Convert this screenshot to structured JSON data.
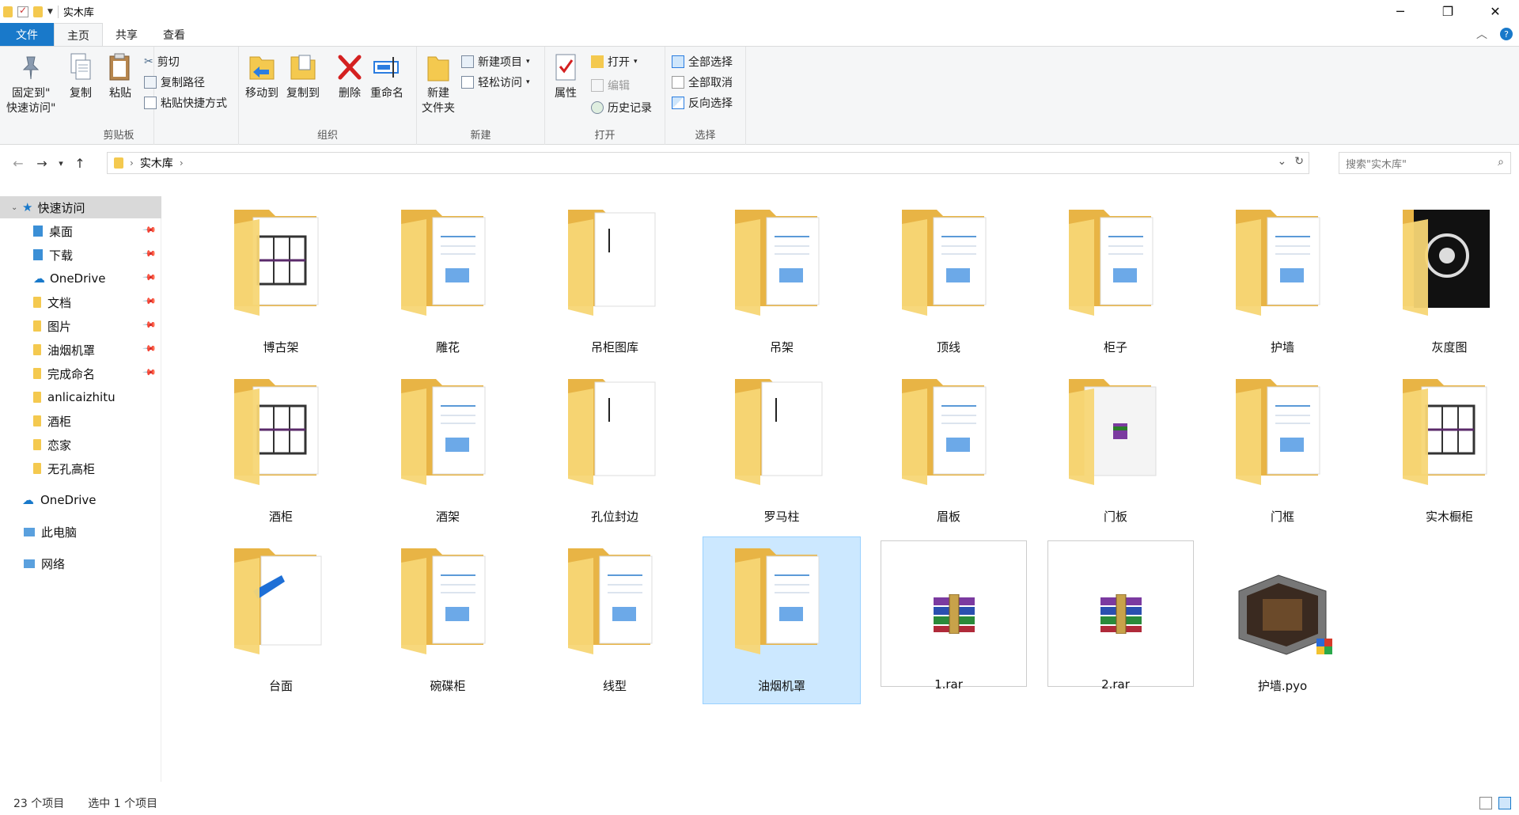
{
  "window": {
    "title": "实木库",
    "controls": {
      "minimize": "─",
      "maximize": "❐",
      "close": "✕"
    }
  },
  "ribbon_tabs": [
    {
      "label": "文件",
      "style": "file"
    },
    {
      "label": "主页",
      "style": "active"
    },
    {
      "label": "共享",
      "style": ""
    },
    {
      "label": "查看",
      "style": ""
    }
  ],
  "ribbon": {
    "clipboard": {
      "label": "剪贴板",
      "pin_label_1": "固定到\"",
      "pin_label_2": "快速访问\"",
      "copy": "复制",
      "paste": "粘贴",
      "cut": "剪切",
      "copy_path": "复制路径",
      "paste_shortcut": "粘贴快捷方式"
    },
    "organize": {
      "label": "组织",
      "move_to": "移动到",
      "copy_to": "复制到",
      "delete": "删除",
      "rename": "重命名"
    },
    "new": {
      "label": "新建",
      "new_folder_1": "新建",
      "new_folder_2": "文件夹",
      "new_item": "新建项目",
      "easy_access": "轻松访问"
    },
    "open": {
      "label": "打开",
      "properties": "属性",
      "open": "打开",
      "edit": "编辑",
      "history": "历史记录"
    },
    "select": {
      "label": "选择",
      "select_all": "全部选择",
      "select_none": "全部取消",
      "invert": "反向选择"
    }
  },
  "address": {
    "path": [
      "实木库"
    ],
    "search_placeholder": "搜索\"实木库\""
  },
  "sidebar": {
    "quick_access": "快速访问",
    "items": [
      {
        "label": "桌面",
        "pinned": true,
        "icon": "desktop-folder"
      },
      {
        "label": "下载",
        "pinned": true,
        "icon": "download-folder"
      },
      {
        "label": "OneDrive",
        "pinned": true,
        "icon": "cloud"
      },
      {
        "label": "文档",
        "pinned": true,
        "icon": "documents-folder"
      },
      {
        "label": "图片",
        "pinned": true,
        "icon": "pictures-folder"
      },
      {
        "label": "油烟机罩",
        "pinned": true,
        "icon": "folder"
      },
      {
        "label": "完成命名",
        "pinned": true,
        "icon": "folder"
      },
      {
        "label": "anlicaizhitu",
        "pinned": false,
        "icon": "folder"
      },
      {
        "label": "酒柜",
        "pinned": false,
        "icon": "folder"
      },
      {
        "label": "恋家",
        "pinned": false,
        "icon": "folder"
      },
      {
        "label": "无孔高柜",
        "pinned": false,
        "icon": "folder"
      }
    ],
    "onedrive": "OneDrive",
    "this_pc": "此电脑",
    "network": "网络"
  },
  "files": [
    {
      "name": "博古架",
      "type": "folder-shelf"
    },
    {
      "name": "雕花",
      "type": "folder"
    },
    {
      "name": "吊柜图库",
      "type": "folder-white"
    },
    {
      "name": "吊架",
      "type": "folder"
    },
    {
      "name": "顶线",
      "type": "folder"
    },
    {
      "name": "柜子",
      "type": "folder"
    },
    {
      "name": "护墙",
      "type": "folder"
    },
    {
      "name": "灰度图",
      "type": "folder-gray"
    },
    {
      "name": "酒柜",
      "type": "folder-shelf"
    },
    {
      "name": "酒架",
      "type": "folder"
    },
    {
      "name": "孔位封边",
      "type": "folder-white"
    },
    {
      "name": "罗马柱",
      "type": "folder-white"
    },
    {
      "name": "眉板",
      "type": "folder"
    },
    {
      "name": "门板",
      "type": "folder-rar"
    },
    {
      "name": "门框",
      "type": "folder"
    },
    {
      "name": "实木橱柜",
      "type": "folder-shelf"
    },
    {
      "name": "台面",
      "type": "folder-blue"
    },
    {
      "name": "碗碟柜",
      "type": "folder"
    },
    {
      "name": "线型",
      "type": "folder"
    },
    {
      "name": "油烟机罩",
      "type": "folder",
      "selected": true
    },
    {
      "name": "1.rar",
      "type": "rar"
    },
    {
      "name": "2.rar",
      "type": "rar"
    },
    {
      "name": "护墙.pyo",
      "type": "model"
    }
  ],
  "status": {
    "count": "23 个项目",
    "selection": "选中 1 个项目"
  },
  "colors": {
    "accent": "#1979ca",
    "folder": "#f4c94f",
    "selection": "#cce8ff"
  }
}
